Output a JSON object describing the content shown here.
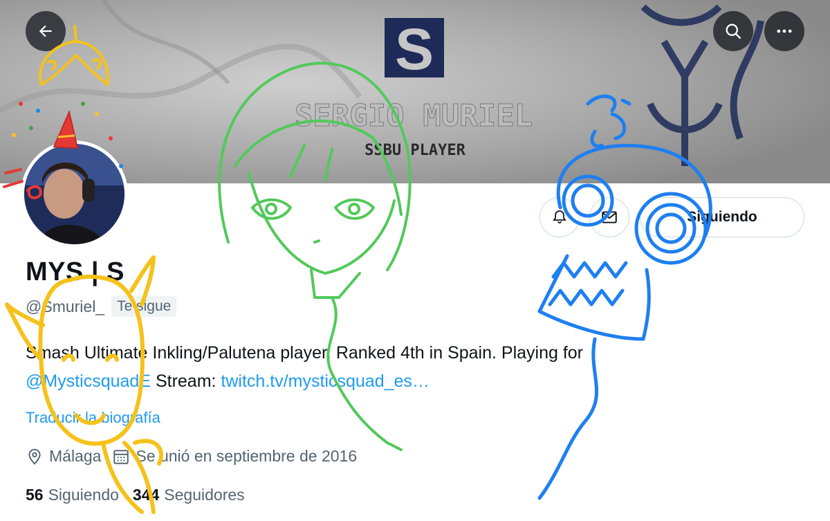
{
  "banner": {
    "logo_letter": "S",
    "title_text": "SERGIO MURIEL",
    "subtitle_text": "SSBU PLAYER"
  },
  "toolbar": {
    "back_icon": "arrow-left-icon",
    "search_icon": "search-icon",
    "more_icon": "more-horizontal-icon"
  },
  "actions": {
    "notifications_icon": "bell-icon",
    "message_icon": "envelope-icon",
    "following_label": "Siguiendo"
  },
  "profile": {
    "display_name": "MYS | S",
    "handle": "@Smuriel_",
    "follows_you": "Te sigue",
    "bio_text": "Smash Ultimate Inkling/Palutena player. Ranked 4th in Spain. Playing for",
    "bio_mention": "@MysticsquadE",
    "bio_stream_label": " Stream: ",
    "bio_link": "twitch.tv/mysticsquad_es…",
    "translate_label": "Traducir la biografía",
    "location": "Málaga",
    "joined": "Se unió en septiembre de 2016",
    "following_count": "56",
    "following_label": "Siguiendo",
    "followers_count": "344",
    "followers_label": "Seguidores"
  },
  "colors": {
    "accent": "#1d9bf0",
    "doodle_yellow": "#f5c21b",
    "doodle_green": "#52c95a",
    "doodle_blue": "#1e7ff0"
  }
}
